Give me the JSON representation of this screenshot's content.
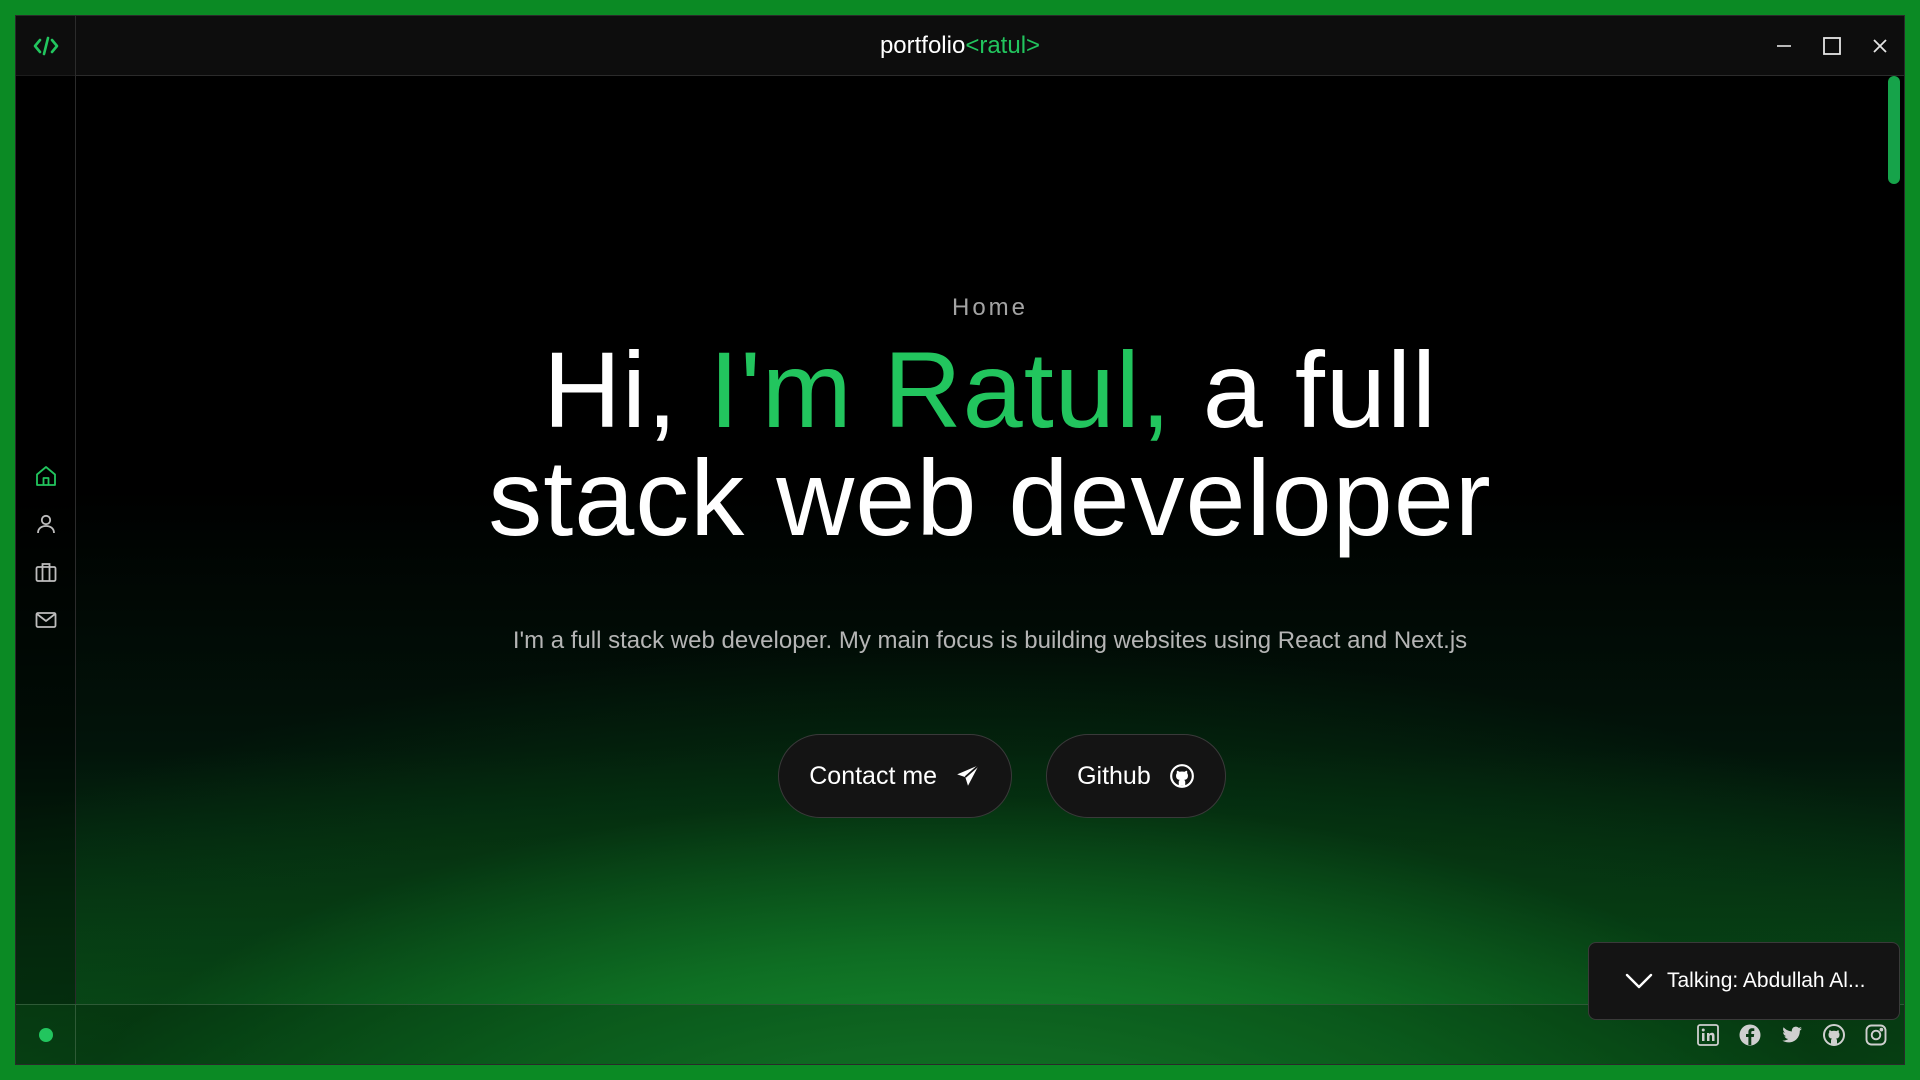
{
  "window": {
    "title_main": "portfolio",
    "title_accent": "<ratul>",
    "minimize_icon": "minimize-icon",
    "maximize_icon": "maximize-icon",
    "close_icon": "close-icon"
  },
  "sidebar": {
    "items": [
      {
        "name": "home",
        "icon": "home-icon",
        "active": true
      },
      {
        "name": "about",
        "icon": "user-icon",
        "active": false
      },
      {
        "name": "projects",
        "icon": "briefcase-icon",
        "active": false
      },
      {
        "name": "contact",
        "icon": "mail-icon",
        "active": false
      }
    ]
  },
  "hero": {
    "section_label": "Home",
    "headline_part1": "Hi, ",
    "headline_green": "I'm Ratul,",
    "headline_part2": " a full",
    "headline_line2": "stack web developer",
    "subtitle": "I'm a full stack web developer. My main focus is building websites using React and Next.js",
    "contact_label": "Contact me",
    "github_label": "Github"
  },
  "toast": {
    "text": "Talking: Abdullah Al..."
  },
  "footer": {
    "socials": [
      "linkedin-icon",
      "facebook-icon",
      "twitter-icon",
      "github-icon",
      "instagram-icon"
    ]
  },
  "colors": {
    "accent": "#22c55e",
    "background": "#000000"
  }
}
